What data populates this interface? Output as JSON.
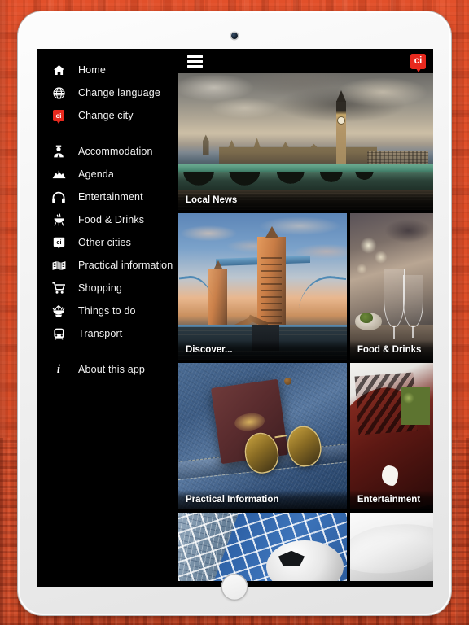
{
  "app": {
    "brand_label": "ci",
    "menu_icon": "hamburger-menu-icon"
  },
  "sidebar": {
    "groups": [
      {
        "items": [
          {
            "label": "Home",
            "icon": "home-icon"
          },
          {
            "label": "Change language",
            "icon": "globe-icon"
          },
          {
            "label": "Change city",
            "icon": "ci-badge-icon"
          }
        ]
      },
      {
        "items": [
          {
            "label": "Accommodation",
            "icon": "concierge-icon"
          },
          {
            "label": "Agenda",
            "icon": "calendar-mountain-icon"
          },
          {
            "label": "Entertainment",
            "icon": "headphones-icon"
          },
          {
            "label": "Food & Drinks",
            "icon": "grill-icon"
          },
          {
            "label": "Other cities",
            "icon": "city-marker-icon"
          },
          {
            "label": "Practical information",
            "icon": "open-map-icon"
          },
          {
            "label": "Shopping",
            "icon": "shopping-cart-icon"
          },
          {
            "label": "Things to do",
            "icon": "fountain-icon"
          },
          {
            "label": "Transport",
            "icon": "bus-icon"
          }
        ]
      },
      {
        "items": [
          {
            "label": "About this app",
            "icon": "info-icon"
          }
        ]
      }
    ]
  },
  "main": {
    "tiles": [
      {
        "caption": "Local News",
        "art": "art-bigben"
      },
      {
        "caption": "Discover...",
        "art": "art-tower"
      },
      {
        "caption": "Food & Drinks",
        "art": "art-wine"
      },
      {
        "caption": "Practical Information",
        "art": "art-jeans"
      },
      {
        "caption": "Entertainment",
        "art": "art-ent"
      },
      {
        "caption": "",
        "art": "art-ball"
      },
      {
        "caption": "",
        "art": "art-pillow"
      }
    ]
  },
  "colors": {
    "accent_red": "#e8291e",
    "backdrop_orange": "#e0522c",
    "app_background": "#000000",
    "sidebar_text": "#f2f2f2"
  }
}
